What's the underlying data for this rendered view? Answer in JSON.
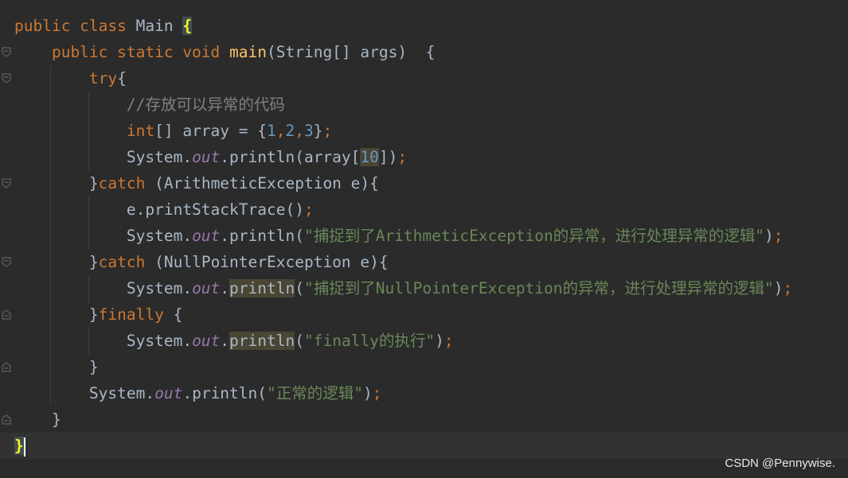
{
  "code": {
    "lines": [
      {
        "tokens": [
          {
            "t": "public class ",
            "c": "kw"
          },
          {
            "t": "Main ",
            "c": ""
          },
          {
            "t": "{",
            "c": "brace-hl"
          }
        ]
      },
      {
        "tokens": [
          {
            "t": "    public static void ",
            "c": "kw"
          },
          {
            "t": "main",
            "c": "fn"
          },
          {
            "t": "(String[] args)  {",
            "c": ""
          }
        ]
      },
      {
        "tokens": [
          {
            "t": "        try",
            "c": "kw"
          },
          {
            "t": "{",
            "c": ""
          }
        ]
      },
      {
        "tokens": [
          {
            "t": "            //存放可以异常的代码",
            "c": "cmt"
          }
        ]
      },
      {
        "tokens": [
          {
            "t": "            int",
            "c": "kw"
          },
          {
            "t": "[] array = {",
            "c": ""
          },
          {
            "t": "1",
            "c": "num"
          },
          {
            "t": ",",
            "c": "kw"
          },
          {
            "t": "2",
            "c": "num"
          },
          {
            "t": ",",
            "c": "kw"
          },
          {
            "t": "3",
            "c": "num"
          },
          {
            "t": "}",
            "c": ""
          },
          {
            "t": ";",
            "c": "kw"
          }
        ]
      },
      {
        "tokens": [
          {
            "t": "            System.",
            "c": ""
          },
          {
            "t": "out",
            "c": "static-field"
          },
          {
            "t": ".println(array[",
            "c": ""
          },
          {
            "t": "10",
            "c": "num idx-hl"
          },
          {
            "t": "])",
            "c": ""
          },
          {
            "t": ";",
            "c": "kw"
          }
        ]
      },
      {
        "tokens": [
          {
            "t": "        }",
            "c": ""
          },
          {
            "t": "catch ",
            "c": "kw"
          },
          {
            "t": "(ArithmeticException e){",
            "c": ""
          }
        ]
      },
      {
        "tokens": [
          {
            "t": "            e.printStackTrace()",
            "c": ""
          },
          {
            "t": ";",
            "c": "kw"
          }
        ]
      },
      {
        "tokens": [
          {
            "t": "            System.",
            "c": ""
          },
          {
            "t": "out",
            "c": "static-field"
          },
          {
            "t": ".println(",
            "c": ""
          },
          {
            "t": "\"捕捉到了ArithmeticException的异常，进行处理异常的逻辑\"",
            "c": "str"
          },
          {
            "t": ")",
            "c": ""
          },
          {
            "t": ";",
            "c": "kw"
          }
        ]
      },
      {
        "tokens": [
          {
            "t": "        }",
            "c": ""
          },
          {
            "t": "catch ",
            "c": "kw"
          },
          {
            "t": "(NullPointerException e){",
            "c": ""
          }
        ]
      },
      {
        "tokens": [
          {
            "t": "            System.",
            "c": ""
          },
          {
            "t": "out",
            "c": "static-field"
          },
          {
            "t": ".",
            "c": ""
          },
          {
            "t": "println",
            "c": "warn"
          },
          {
            "t": "(",
            "c": ""
          },
          {
            "t": "\"捕捉到了NullPointerException的异常，进行处理异常的逻辑\"",
            "c": "str"
          },
          {
            "t": ")",
            "c": ""
          },
          {
            "t": ";",
            "c": "kw"
          }
        ]
      },
      {
        "tokens": [
          {
            "t": "        }",
            "c": ""
          },
          {
            "t": "finally ",
            "c": "kw"
          },
          {
            "t": "{",
            "c": ""
          }
        ]
      },
      {
        "tokens": [
          {
            "t": "            System.",
            "c": ""
          },
          {
            "t": "out",
            "c": "static-field"
          },
          {
            "t": ".",
            "c": ""
          },
          {
            "t": "println",
            "c": "warn"
          },
          {
            "t": "(",
            "c": ""
          },
          {
            "t": "\"finally的执行\"",
            "c": "str"
          },
          {
            "t": ")",
            "c": ""
          },
          {
            "t": ";",
            "c": "kw"
          }
        ]
      },
      {
        "tokens": [
          {
            "t": "        }",
            "c": ""
          }
        ]
      },
      {
        "tokens": [
          {
            "t": "        System.",
            "c": ""
          },
          {
            "t": "out",
            "c": "static-field"
          },
          {
            "t": ".println(",
            "c": ""
          },
          {
            "t": "\"正常的逻辑\"",
            "c": "str"
          },
          {
            "t": ")",
            "c": ""
          },
          {
            "t": ";",
            "c": "kw"
          }
        ]
      },
      {
        "tokens": [
          {
            "t": "    }",
            "c": ""
          }
        ]
      },
      {
        "tokens": [
          {
            "t": "}",
            "c": "brace-hl"
          }
        ],
        "current": true,
        "caret": true
      }
    ]
  },
  "watermark": "CSDN @Pennywise.",
  "colors": {
    "background": "#2b2b2b",
    "keyword": "#cc7832",
    "method": "#ffc66d",
    "static_field": "#9876aa",
    "number": "#6897bb",
    "string": "#6a8759",
    "comment": "#808080",
    "plain": "#a9b7c6"
  },
  "gutter": {
    "fold_markers": [
      {
        "line": 1,
        "icon": "fold-open-icon"
      },
      {
        "line": 2,
        "icon": "fold-open-icon"
      },
      {
        "line": 6,
        "icon": "fold-open-icon"
      },
      {
        "line": 9,
        "icon": "fold-open-icon"
      },
      {
        "line": 11,
        "icon": "fold-close-icon"
      },
      {
        "line": 13,
        "icon": "fold-close-icon"
      },
      {
        "line": 15,
        "icon": "fold-close-icon"
      }
    ]
  }
}
